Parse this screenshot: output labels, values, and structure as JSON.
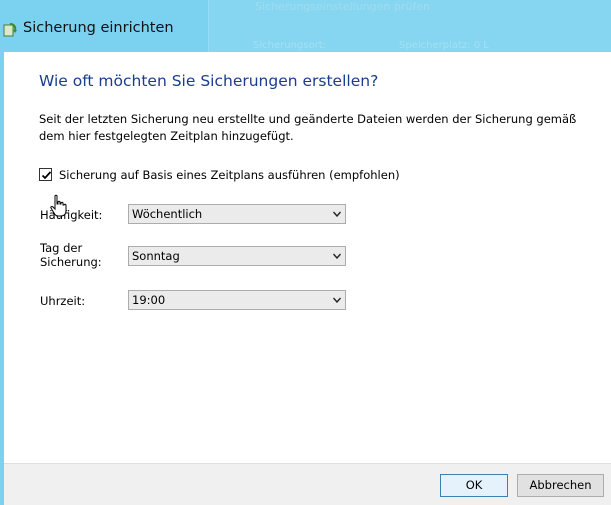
{
  "window": {
    "title": "Sicherung einrichten",
    "background_ghost": [
      "Sicherungseinstellungen prüfen",
      "Sicherungsort:",
      "Speicherplatz: 0 L"
    ]
  },
  "page": {
    "heading": "Wie oft möchten Sie Sicherungen erstellen?",
    "description": "Seit der letzten Sicherung neu erstellte und geänderte Dateien werden der Sicherung gemäß dem hier festgelegten Zeitplan hinzugefügt."
  },
  "schedule": {
    "checkbox_label": "Sicherung auf Basis eines Zeitplans ausführen (empfohlen)",
    "checked": true,
    "frequency": {
      "label": "Häufigkeit:",
      "value": "Wöchentlich"
    },
    "day": {
      "label": "Tag der Sicherung:",
      "label_line1": "Tag der",
      "label_line2": "Sicherung:",
      "value": "Sonntag"
    },
    "time": {
      "label": "Uhrzeit:",
      "value": "19:00"
    }
  },
  "footer": {
    "ok_label": "OK",
    "cancel_label": "Abbrechen"
  },
  "colors": {
    "titlebar": "#7ad1f0",
    "heading": "#1a3d8f",
    "footer": "#f0f0f0"
  },
  "icons": [
    "backup-app-icon",
    "checkmark-icon",
    "chevron-down-icon",
    "hand-cursor-icon"
  ]
}
